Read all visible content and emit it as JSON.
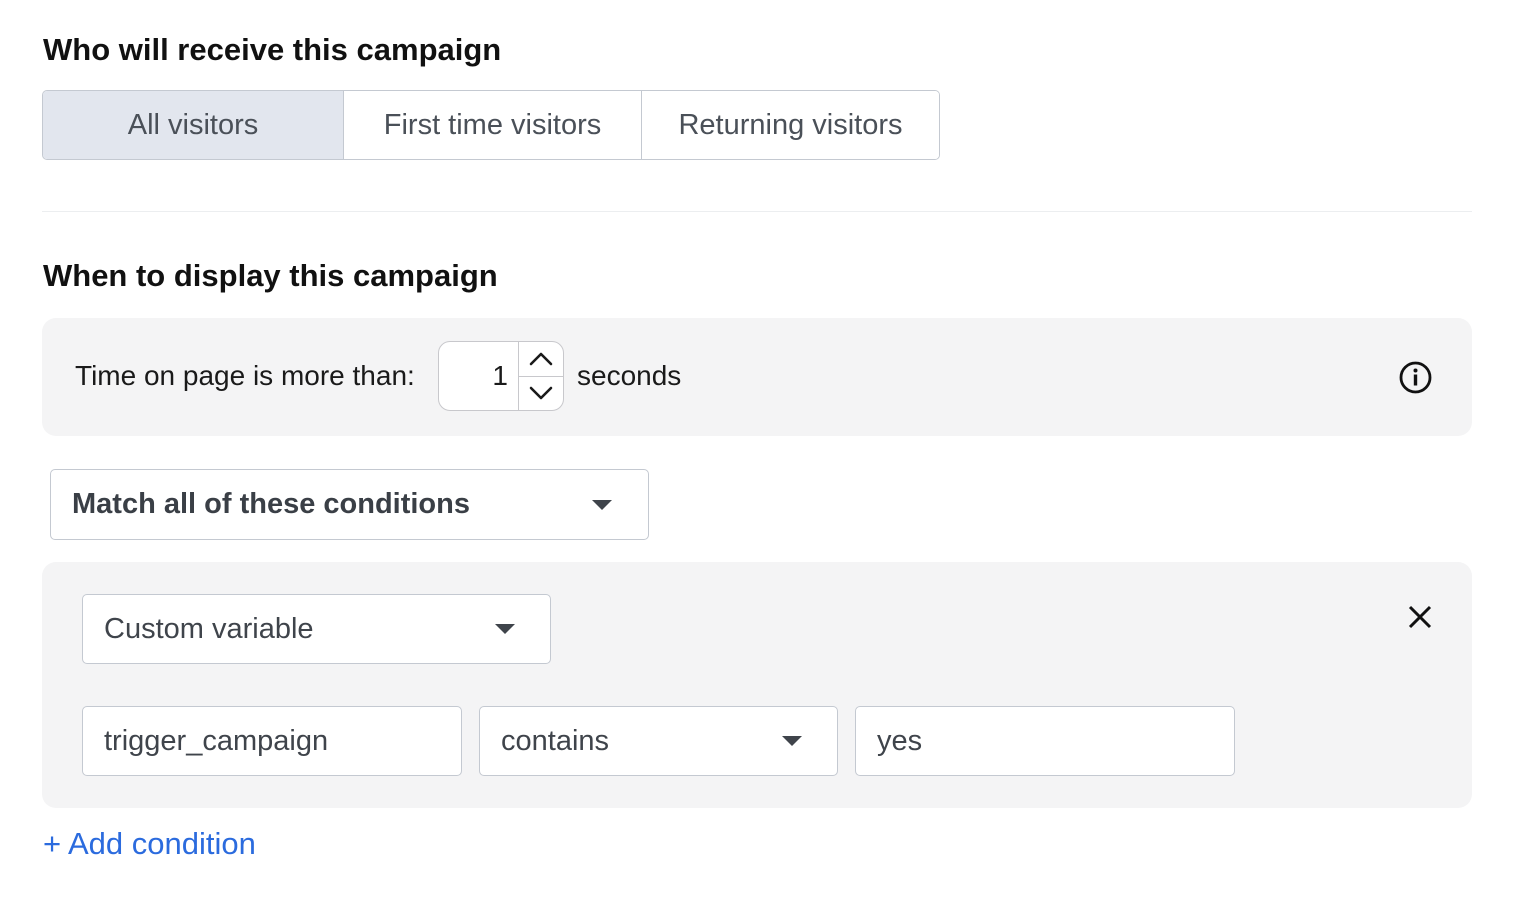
{
  "audience": {
    "heading": "Who will receive this campaign",
    "options": [
      {
        "label": "All visitors",
        "selected": true
      },
      {
        "label": "First time visitors",
        "selected": false
      },
      {
        "label": "Returning visitors",
        "selected": false
      }
    ]
  },
  "display": {
    "heading": "When to display this campaign",
    "time_label": "Time on page is more than:",
    "time_value": "1",
    "time_unit": "seconds",
    "info_icon": "info-circle-icon",
    "match_select": "Match all of these conditions",
    "condition": {
      "type_select": "Custom variable",
      "variable_name": "trigger_campaign",
      "operator_select": "contains",
      "value": "yes",
      "remove_icon": "close-icon"
    },
    "add_condition_label": "+ Add condition"
  },
  "colors": {
    "accent": "#2b6bde",
    "selected_bg": "#e2e6ee",
    "panel_bg": "#f4f4f5"
  }
}
